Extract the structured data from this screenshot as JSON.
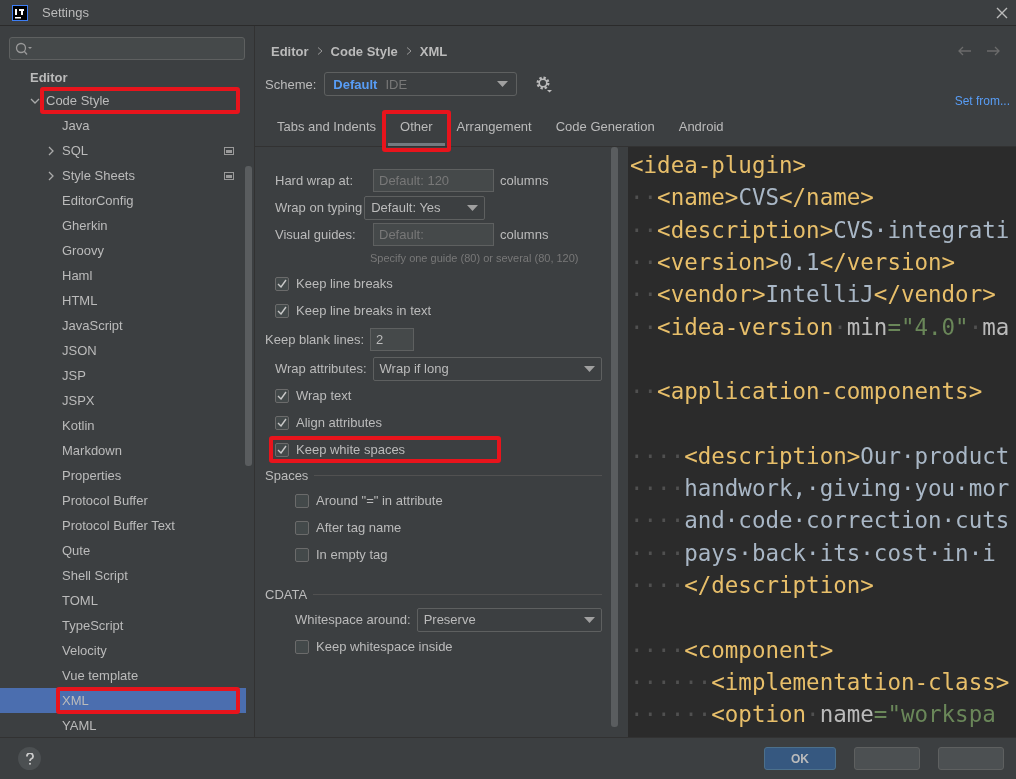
{
  "window": {
    "title": "Settings"
  },
  "sidebar": {
    "section": "Editor",
    "items": [
      {
        "label": "Code Style",
        "expanded": true,
        "highlighted": true,
        "selected": false,
        "children": [
          {
            "label": "Java",
            "selected": false,
            "highlighted": false
          },
          {
            "label": "SQL",
            "expanded": false,
            "scheme_icon": true,
            "selected": false,
            "highlighted": false
          },
          {
            "label": "Style Sheets",
            "expanded": false,
            "scheme_icon": true,
            "selected": false,
            "highlighted": false
          },
          {
            "label": "EditorConfig",
            "selected": false,
            "highlighted": false
          },
          {
            "label": "Gherkin",
            "selected": false,
            "highlighted": false
          },
          {
            "label": "Groovy",
            "selected": false,
            "highlighted": false
          },
          {
            "label": "Haml",
            "selected": false,
            "highlighted": false
          },
          {
            "label": "HTML",
            "selected": false,
            "highlighted": false
          },
          {
            "label": "JavaScript",
            "selected": false,
            "highlighted": false
          },
          {
            "label": "JSON",
            "selected": false,
            "highlighted": false
          },
          {
            "label": "JSP",
            "selected": false,
            "highlighted": false
          },
          {
            "label": "JSPX",
            "selected": false,
            "highlighted": false
          },
          {
            "label": "Kotlin",
            "selected": false,
            "highlighted": false
          },
          {
            "label": "Markdown",
            "selected": false,
            "highlighted": false
          },
          {
            "label": "Properties",
            "selected": false,
            "highlighted": false
          },
          {
            "label": "Protocol Buffer",
            "selected": false,
            "highlighted": false
          },
          {
            "label": "Protocol Buffer Text",
            "selected": false,
            "highlighted": false
          },
          {
            "label": "Qute",
            "selected": false,
            "highlighted": false
          },
          {
            "label": "Shell Script",
            "selected": false,
            "highlighted": false
          },
          {
            "label": "TOML",
            "selected": false,
            "highlighted": false
          },
          {
            "label": "TypeScript",
            "selected": false,
            "highlighted": false
          },
          {
            "label": "Velocity",
            "selected": false,
            "highlighted": false
          },
          {
            "label": "Vue template",
            "selected": false,
            "highlighted": false
          },
          {
            "label": "XML",
            "selected": true,
            "highlighted": true
          },
          {
            "label": "YAML",
            "selected": false,
            "highlighted": false
          }
        ]
      }
    ]
  },
  "breadcrumb": [
    "Editor",
    "Code Style",
    "XML"
  ],
  "scheme": {
    "label": "Scheme:",
    "name": "Default",
    "scope": "IDE"
  },
  "set_from": "Set from...",
  "tabs": [
    {
      "label": "Tabs and Indents",
      "selected": false,
      "highlighted": false
    },
    {
      "label": "Other",
      "selected": true,
      "highlighted": true
    },
    {
      "label": "Arrangement",
      "selected": false,
      "highlighted": false
    },
    {
      "label": "Code Generation",
      "selected": false,
      "highlighted": false
    },
    {
      "label": "Android",
      "selected": false,
      "highlighted": false
    }
  ],
  "options": [
    {
      "kind": "textfield",
      "label": "Hard wrap at:",
      "placeholder": "Default: 120",
      "suffix": "columns"
    },
    {
      "kind": "dropdown",
      "label": "Wrap on typing",
      "value": "Default: Yes",
      "wide": false
    },
    {
      "kind": "textfield",
      "label": "Visual guides:",
      "placeholder": "Default:",
      "suffix": "columns"
    },
    {
      "kind": "hint",
      "text": "Specify one guide (80) or several (80, 120)"
    },
    {
      "kind": "checkbox",
      "label": "Keep line breaks",
      "checked": true,
      "highlighted": false
    },
    {
      "kind": "checkbox",
      "label": "Keep line breaks in text",
      "checked": true,
      "highlighted": false
    },
    {
      "kind": "number",
      "label": "Keep blank lines:",
      "value": "2"
    },
    {
      "kind": "dropdown",
      "label": "Wrap attributes:",
      "value": "Wrap if long",
      "wide": true
    },
    {
      "kind": "checkbox",
      "label": "Wrap text",
      "checked": true,
      "highlighted": false
    },
    {
      "kind": "checkbox",
      "label": "Align attributes",
      "checked": true,
      "highlighted": false
    },
    {
      "kind": "checkbox",
      "label": "Keep white spaces",
      "checked": true,
      "highlighted": true
    },
    {
      "kind": "section",
      "title": "Spaces",
      "items": [
        {
          "kind": "checkbox",
          "label": "Around \"=\" in attribute",
          "checked": false,
          "highlighted": false
        },
        {
          "kind": "checkbox",
          "label": "After tag name",
          "checked": false,
          "highlighted": false
        },
        {
          "kind": "checkbox",
          "label": "In empty tag",
          "checked": false,
          "highlighted": false
        }
      ]
    },
    {
      "kind": "section",
      "title": "CDATA",
      "items": [
        {
          "kind": "dropdown",
          "label": "Whitespace around:",
          "value": "Preserve",
          "wide": true
        },
        {
          "kind": "checkbox",
          "label": "Keep whitespace inside",
          "checked": false,
          "highlighted": false
        }
      ]
    }
  ],
  "code": [
    {
      "kind": "code",
      "tokens": [
        {
          "kind": "tag",
          "text": "<idea-plugin>"
        }
      ]
    },
    {
      "kind": "code",
      "tokens": [
        {
          "kind": "ws",
          "text": "··"
        },
        {
          "kind": "tag",
          "text": "<name>"
        },
        {
          "kind": "text",
          "text": "CVS"
        },
        {
          "kind": "tag",
          "text": "</name>"
        }
      ]
    },
    {
      "kind": "code",
      "tokens": [
        {
          "kind": "ws",
          "text": "··"
        },
        {
          "kind": "tag",
          "text": "<description>"
        },
        {
          "kind": "text",
          "text": "CVS·integrati"
        }
      ]
    },
    {
      "kind": "code",
      "tokens": [
        {
          "kind": "ws",
          "text": "··"
        },
        {
          "kind": "tag",
          "text": "<version>"
        },
        {
          "kind": "text",
          "text": "0.1"
        },
        {
          "kind": "tag",
          "text": "</version>"
        }
      ]
    },
    {
      "kind": "code",
      "tokens": [
        {
          "kind": "ws",
          "text": "··"
        },
        {
          "kind": "tag",
          "text": "<vendor>"
        },
        {
          "kind": "text",
          "text": "IntelliJ"
        },
        {
          "kind": "tag",
          "text": "</vendor>"
        }
      ]
    },
    {
      "kind": "code",
      "tokens": [
        {
          "kind": "ws",
          "text": "··"
        },
        {
          "kind": "tag",
          "text": "<idea-version"
        },
        {
          "kind": "ws",
          "text": "·"
        },
        {
          "kind": "attr",
          "text": "min"
        },
        {
          "kind": "string",
          "text": "=\"4.0\""
        },
        {
          "kind": "ws",
          "text": "·"
        },
        {
          "kind": "attr",
          "text": "ma"
        }
      ]
    },
    {
      "kind": "blank"
    },
    {
      "kind": "code",
      "tokens": [
        {
          "kind": "ws",
          "text": "··"
        },
        {
          "kind": "tag",
          "text": "<application-components>"
        }
      ]
    },
    {
      "kind": "blank"
    },
    {
      "kind": "code",
      "tokens": [
        {
          "kind": "ws",
          "text": "····"
        },
        {
          "kind": "tag",
          "text": "<description>"
        },
        {
          "kind": "text",
          "text": "Our·product"
        }
      ]
    },
    {
      "kind": "code",
      "tokens": [
        {
          "kind": "ws",
          "text": "····"
        },
        {
          "kind": "text",
          "text": "handwork,·giving·you·mor"
        }
      ]
    },
    {
      "kind": "code",
      "tokens": [
        {
          "kind": "ws",
          "text": "····"
        },
        {
          "kind": "text",
          "text": "and·code·correction·cuts"
        }
      ]
    },
    {
      "kind": "code",
      "tokens": [
        {
          "kind": "ws",
          "text": "····"
        },
        {
          "kind": "text",
          "text": "pays·back·its·cost·in·i"
        }
      ]
    },
    {
      "kind": "code",
      "tokens": [
        {
          "kind": "ws",
          "text": "····"
        },
        {
          "kind": "tag",
          "text": "</description>"
        }
      ]
    },
    {
      "kind": "blank"
    },
    {
      "kind": "code",
      "tokens": [
        {
          "kind": "ws",
          "text": "····"
        },
        {
          "kind": "tag",
          "text": "<component>"
        }
      ]
    },
    {
      "kind": "code",
      "tokens": [
        {
          "kind": "ws",
          "text": "······"
        },
        {
          "kind": "tag",
          "text": "<implementation-class>"
        }
      ]
    },
    {
      "kind": "code",
      "tokens": [
        {
          "kind": "ws",
          "text": "······"
        },
        {
          "kind": "tag",
          "text": "<option"
        },
        {
          "kind": "ws",
          "text": "·"
        },
        {
          "kind": "attr",
          "text": "name"
        },
        {
          "kind": "string",
          "text": "=\"workspa"
        }
      ]
    }
  ],
  "footer": {
    "ok": "OK"
  }
}
